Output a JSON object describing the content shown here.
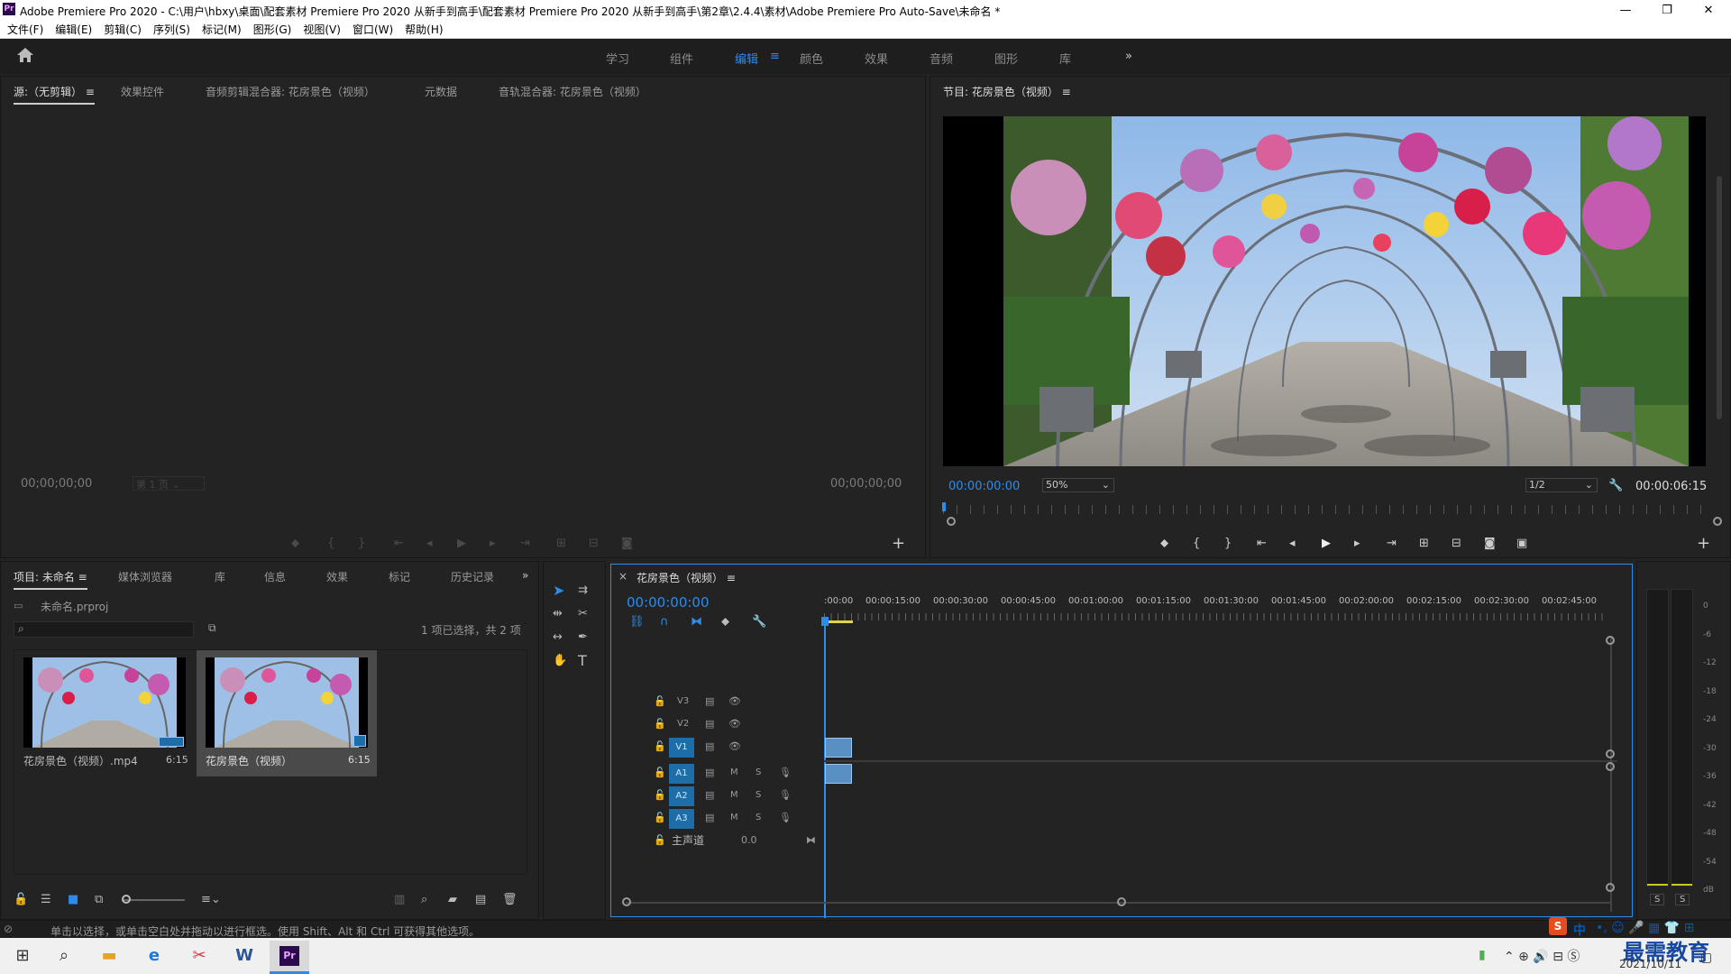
{
  "window": {
    "title": "Adobe Premiere Pro 2020 - C:\\用户\\hbxy\\桌面\\配套素材 Premiere Pro 2020 从新手到高手\\配套素材 Premiere Pro 2020 从新手到高手\\第2章\\2.4.4\\素材\\Adobe Premiere Pro Auto-Save\\未命名 *",
    "minimize": "—",
    "maximize": "❐",
    "close": "✕",
    "logo": "Pr"
  },
  "menu": [
    "文件(F)",
    "编辑(E)",
    "剪辑(C)",
    "序列(S)",
    "标记(M)",
    "图形(G)",
    "视图(V)",
    "窗口(W)",
    "帮助(H)"
  ],
  "workspaces": [
    "学习",
    "组件",
    "编辑",
    "颜色",
    "效果",
    "音频",
    "图形",
    "库"
  ],
  "workspace_active": "编辑",
  "source_panel": {
    "tabs": [
      "源:（无剪辑）",
      "效果控件",
      "音频剪辑混合器: 花房景色（视频）",
      "元数据",
      "音轨混合器: 花房景色（视频）"
    ],
    "timecode_in": "00;00;00;00",
    "timecode_out": "00;00;00;00",
    "page": "第 1 页"
  },
  "program_panel": {
    "title": "节目: 花房景色（视频）",
    "timecode": "00:00:00:00",
    "zoom": "50%",
    "quality": "1/2",
    "duration": "00:00:06:15"
  },
  "project_panel": {
    "tabs": [
      "项目: 未命名",
      "媒体浏览器",
      "库",
      "信息",
      "效果",
      "标记",
      "历史记录"
    ],
    "file": "未命名.prproj",
    "selection": "1 项已选择，共 2 项",
    "items": [
      {
        "name": "花房景色（视频）.mp4",
        "duration": "6:15"
      },
      {
        "name": "花房景色（视频）",
        "duration": "6:15"
      }
    ]
  },
  "timeline": {
    "title": "花房景色（视频）",
    "timecode": "00:00:00:00",
    "ruler": [
      ":00:00",
      "00:00:15:00",
      "00:00:30:00",
      "00:00:45:00",
      "00:01:00:00",
      "00:01:15:00",
      "00:01:30:00",
      "00:01:45:00",
      "00:02:00:00",
      "00:02:15:00",
      "00:02:30:00",
      "00:02:45:00"
    ],
    "video_tracks": [
      "V3",
      "V2",
      "V1"
    ],
    "audio_tracks": [
      "A1",
      "A2",
      "A3"
    ],
    "master": "主声道",
    "master_value": "0.0",
    "mute": "M",
    "solo": "S"
  },
  "meter": {
    "labels": [
      "0",
      "-6",
      "-12",
      "-18",
      "-24",
      "-30",
      "-36",
      "-42",
      "-48",
      "-54",
      "dB"
    ],
    "solo": "S"
  },
  "status_text": "单击以选择，或单击空白处并拖动以进行框选。使用 Shift、Alt 和 Ctrl 可获得其他选项。",
  "taskbar": {
    "date": "2021/10/11",
    "ime": "中",
    "watermark": "最需教育"
  }
}
